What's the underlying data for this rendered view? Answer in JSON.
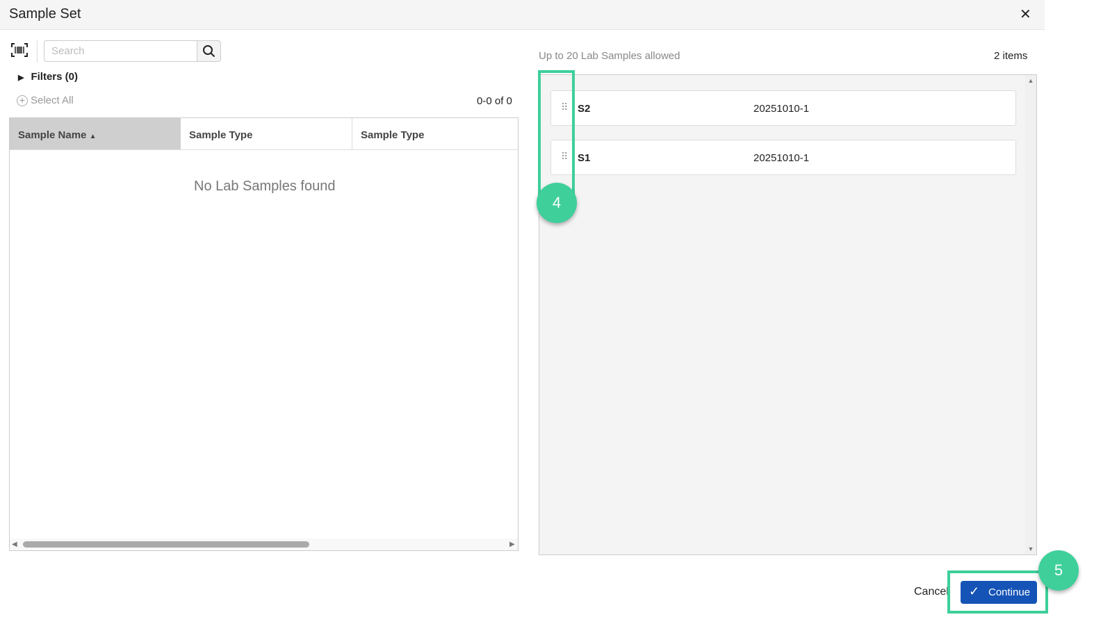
{
  "dialog": {
    "title": "Sample Set",
    "close_icon": "close-icon"
  },
  "left": {
    "search_placeholder": "Search",
    "filters_label": "Filters (0)",
    "select_all_label": "Select All",
    "pagination": "0-0 of 0",
    "columns": [
      "Sample Name",
      "Sample Type",
      "Sample Type"
    ],
    "sort": "ascending",
    "empty_message": "No Lab Samples found"
  },
  "right": {
    "limit_text": "Up to 20 Lab Samples allowed",
    "items_count": "2 items",
    "items": [
      {
        "name": "S2",
        "value": "20251010-1"
      },
      {
        "name": "S1",
        "value": "20251010-1"
      }
    ]
  },
  "footer": {
    "cancel_label": "Cancel",
    "continue_label": "Continue"
  },
  "annotations": {
    "step4": "4",
    "step5": "5",
    "highlight_color": "#3ecf9b"
  }
}
